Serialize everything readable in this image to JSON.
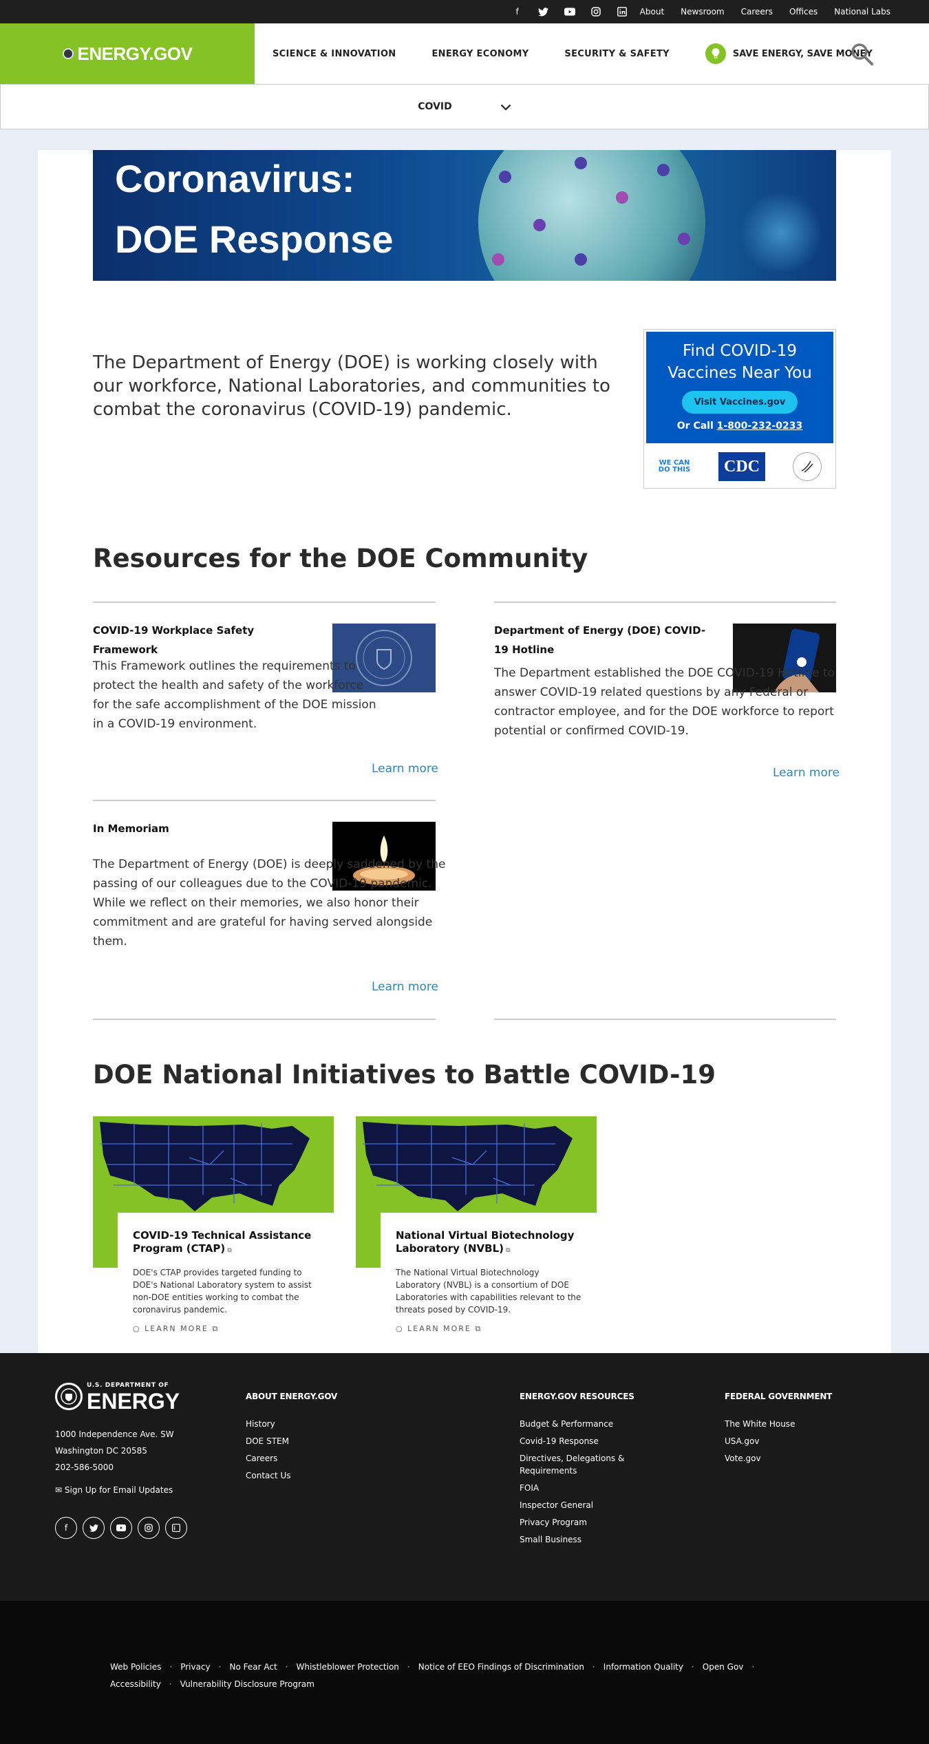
{
  "topbar": {
    "social": [
      "facebook-icon",
      "twitter-icon",
      "youtube-icon",
      "instagram-icon",
      "linkedin-icon"
    ],
    "links": [
      "About",
      "Newsroom",
      "Careers",
      "Offices",
      "National Labs"
    ]
  },
  "nav": {
    "logo": "ENERGY.GOV",
    "items": [
      "SCIENCE & INNOVATION",
      "ENERGY ECONOMY",
      "SECURITY & SAFETY"
    ],
    "save": "SAVE ENERGY, SAVE MONEY",
    "accent": "#84c225"
  },
  "subnav": {
    "label": "COVID"
  },
  "banner": {
    "line1": "Coronavirus:",
    "line2": "DOE Response"
  },
  "intro": "The Department of Energy (DOE) is working closely with our workforce, National Laboratories, and communities to combat the coronavirus (COVID-19) pandemic.",
  "vax": {
    "title": "Find COVID-19 Vaccines Near You",
    "button": "Visit Vaccines.gov",
    "call_prefix": "Or Call",
    "phone": "1-800-232-0233",
    "logo1": "WE CAN DO THIS",
    "logo2": "CDC"
  },
  "resources": {
    "heading": "Resources for the DOE Community",
    "learn": "Learn more",
    "cards": [
      {
        "title": "COVID-19 Workplace Safety Framework",
        "body": "This Framework outlines the requirements to protect the health and safety of the workforce for the safe accomplishment of the DOE mission in a COVID-19 environment."
      },
      {
        "title": "Department of Energy (DOE) COVID-19 Hotline",
        "body": "The Department established the DOE COVID-19 Hotline to answer COVID-19 related questions by any Federal or contractor employee, and for the DOE workforce to report potential or confirmed COVID-19."
      },
      {
        "title": "In Memoriam",
        "body": "The Department of Energy (DOE) is deeply saddened by the passing of our colleagues due to the COVID-19 pandemic. While we reflect on their memories, we also honor their commitment and are grateful for having served alongside them."
      }
    ]
  },
  "initiatives": {
    "heading": "DOE National Initiatives to Battle COVID-19",
    "learn": "LEARN MORE",
    "items": [
      {
        "title": "COVID-19 Technical Assistance Program (CTAP)",
        "body": "DOE's CTAP provides targeted funding to DOE's National Laboratory system to assist non-DOE entities working to combat the coronavirus pandemic."
      },
      {
        "title": "National Virtual Biotechnology Laboratory (NVBL)",
        "body": "The National Virtual Biotechnology Laboratory (NVBL) is a consortium of DOE Laboratories with capabilities relevant to the threats posed by COVID-19."
      }
    ]
  },
  "footer": {
    "seal_top": "U.S. DEPARTMENT OF",
    "seal_word": "ENERGY",
    "address": [
      "1000 Independence Ave. SW",
      "Washington DC 20585",
      "202-586-5000"
    ],
    "email": "Sign Up for Email Updates",
    "col1": {
      "heading": "ABOUT ENERGY.GOV",
      "items": [
        "History",
        "DOE STEM",
        "Careers",
        "Contact Us"
      ]
    },
    "col2": {
      "heading": "ENERGY.GOV RESOURCES",
      "items": [
        "Budget & Performance",
        "Covid-19 Response",
        "Directives, Delegations & Requirements",
        "FOIA",
        "Inspector General",
        "Privacy Program",
        "Small Business"
      ]
    },
    "col3": {
      "heading": "FEDERAL GOVERNMENT",
      "items": [
        "The White House",
        "USA.gov",
        "Vote.gov"
      ]
    }
  },
  "bottom": {
    "links": [
      "Web Policies",
      "Privacy",
      "No Fear Act",
      "Whistleblower Protection",
      "Notice of EEO Findings of Discrimination",
      "Information Quality",
      "Open Gov",
      "Accessibility",
      "Vulnerability Disclosure Program"
    ]
  }
}
